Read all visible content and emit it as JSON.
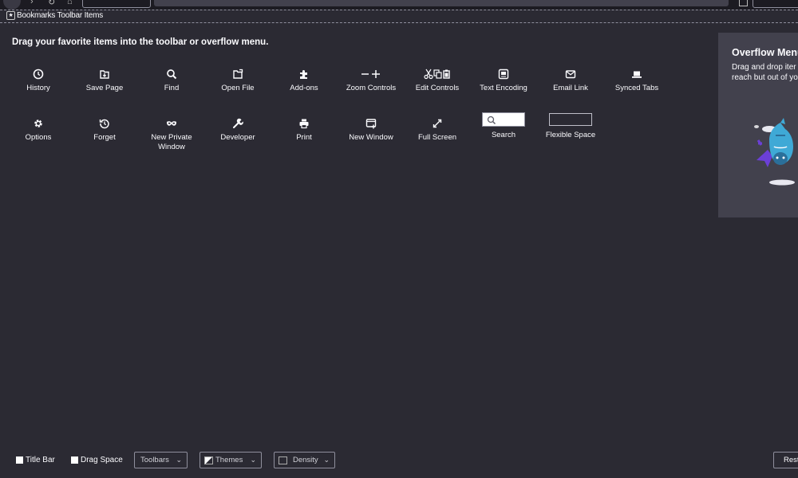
{
  "bookmarks_toolbar": {
    "label": "Bookmarks Toolbar Items"
  },
  "heading": "Drag your favorite items into the toolbar or overflow menu.",
  "palette": [
    {
      "label": "History",
      "icon": "clock-icon"
    },
    {
      "label": "Save Page",
      "icon": "save-page-icon"
    },
    {
      "label": "Find",
      "icon": "search-icon"
    },
    {
      "label": "Open File",
      "icon": "open-file-icon"
    },
    {
      "label": "Add-ons",
      "icon": "puzzle-icon"
    },
    {
      "label": "Zoom Controls",
      "icon": "zoom-controls-icon"
    },
    {
      "label": "Edit Controls",
      "icon": "edit-controls-icon"
    },
    {
      "label": "Text Encoding",
      "icon": "text-encoding-icon"
    },
    {
      "label": "Email Link",
      "icon": "envelope-icon"
    },
    {
      "label": "Synced Tabs",
      "icon": "laptop-icon"
    },
    {
      "label": "Options",
      "icon": "gear-icon"
    },
    {
      "label": "Forget",
      "icon": "forget-icon"
    },
    {
      "label": "New Private Window",
      "icon": "mask-icon"
    },
    {
      "label": "Developer",
      "icon": "wrench-icon"
    },
    {
      "label": "Print",
      "icon": "printer-icon"
    },
    {
      "label": "New Window",
      "icon": "new-window-icon"
    },
    {
      "label": "Full Screen",
      "icon": "expand-icon"
    },
    {
      "label": "Search",
      "icon": "search-field"
    },
    {
      "label": "Flexible Space",
      "icon": "flexible-space"
    }
  ],
  "overflow": {
    "title": "Overflow Menu",
    "desc_line1": "Drag and drop iter",
    "desc_line2": "reach but out of yo"
  },
  "bottom": {
    "title_bar": "Title Bar",
    "drag_space": "Drag Space",
    "toolbars": "Toolbars",
    "themes": "Themes",
    "density": "Density",
    "restore": "Rest"
  },
  "colors": {
    "background": "#2b2a33",
    "panel": "#42414d",
    "text": "#fbfbfe",
    "accent_blue": "#3fa9d6",
    "accent_purple": "#6b3fd6"
  }
}
